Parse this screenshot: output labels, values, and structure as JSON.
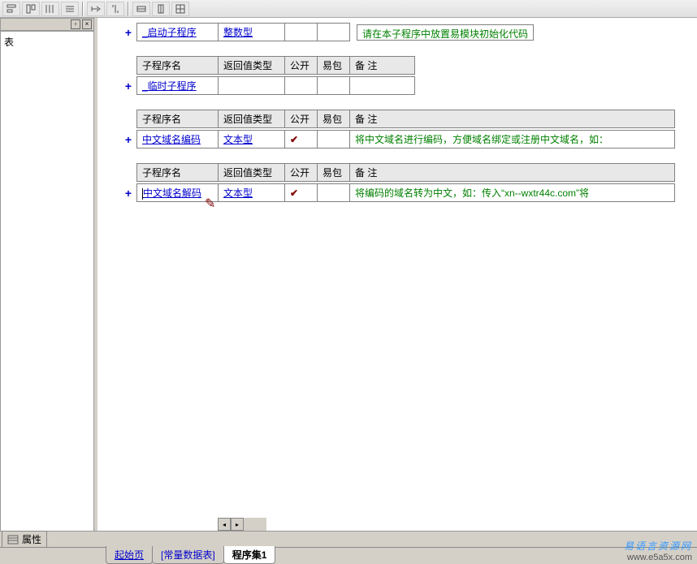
{
  "toolbar_icons": [
    "align-top",
    "align-bottom",
    "align-left",
    "align-right",
    "distribute-h",
    "distribute-v",
    "bracket-l",
    "bracket-r",
    "stretch",
    "same-w",
    "same-h",
    "same-both"
  ],
  "panel": {
    "side_char": "表"
  },
  "headers": {
    "name": "子程序名",
    "ret": "返回值类型",
    "pub": "公开",
    "yi": "易包",
    "remark": "备 注"
  },
  "subs": [
    {
      "name": "_启动子程序",
      "ret": "整数型",
      "pub": "",
      "yi": "",
      "remark_box": "请在本子程序中放置易模块初始化代码"
    },
    {
      "name": "_临时子程序",
      "ret": "",
      "pub": "",
      "yi": "",
      "remark": ""
    },
    {
      "name": "中文域名编码",
      "ret": "文本型",
      "pub": "✔",
      "yi": "",
      "remark": "将中文域名进行编码，方便域名绑定或注册中文域名，如："
    },
    {
      "name": "中文域名解码",
      "ret": "文本型",
      "pub": "✔",
      "yi": "",
      "remark": "将编码的域名转为中文，如：传入“xn--wxtr44c.com”将",
      "editing": true
    }
  ],
  "properties_label": "属性",
  "tabs": [
    {
      "label": "起始页",
      "active": false,
      "underline": true
    },
    {
      "label": "[常量数据表]",
      "active": false
    },
    {
      "label": "程序集1",
      "active": true
    }
  ],
  "watermark": {
    "cn": "易语言资源网",
    "en": "www.e5a5x.com"
  }
}
